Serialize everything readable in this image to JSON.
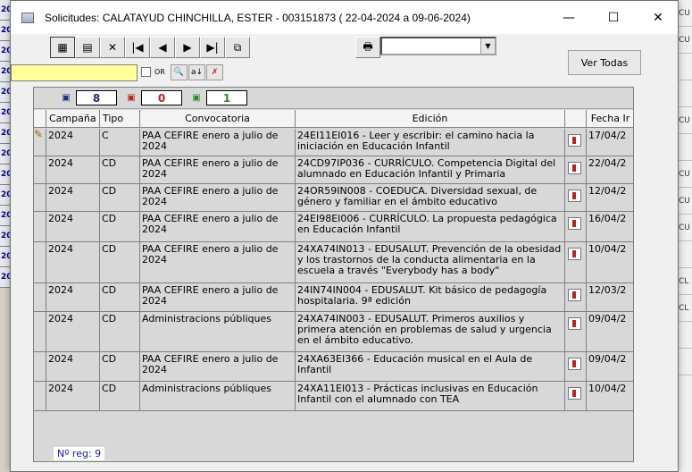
{
  "window": {
    "title": "Solicitudes: CALATAYUD CHINCHILLA, ESTER - 003151873  ( 22-04-2024 a  09-06-2024)"
  },
  "titlebar_controls": {
    "minimize": "—",
    "maximize": "☐",
    "close": "✕"
  },
  "toolbar": {
    "buttons": [
      {
        "name": "grid-view-icon",
        "glyph": "▦"
      },
      {
        "name": "form-view-icon",
        "glyph": "▤"
      },
      {
        "name": "cancel-x-icon",
        "glyph": "✕"
      },
      {
        "name": "first-record-icon",
        "glyph": "|◀"
      },
      {
        "name": "prev-record-icon",
        "glyph": "◀"
      },
      {
        "name": "next-record-icon",
        "glyph": "▶"
      },
      {
        "name": "last-record-icon",
        "glyph": "▶|"
      },
      {
        "name": "copy-records-icon",
        "glyph": "⧉"
      }
    ],
    "print": "🖶",
    "combo_arrow": "▼"
  },
  "ver_todas_label": "Ver Todas",
  "search": {
    "or_label": "OR",
    "find_glyph": "🔍",
    "sort_glyph": "a↓",
    "clear_glyph": "✗"
  },
  "counters": [
    {
      "icon": "doc-check-icon",
      "color": "#1f2f7a",
      "value": "8"
    },
    {
      "icon": "doc-x-icon",
      "color": "#c02020",
      "value": "0"
    },
    {
      "icon": "doc-ok-icon",
      "color": "#2a8a2a",
      "value": "1"
    }
  ],
  "columns": [
    "Campaña",
    "Tipo",
    "Convocatoria",
    "Edición",
    "",
    "Fecha Ir"
  ],
  "rows": [
    {
      "edit": "✎",
      "campana": "2024",
      "tipo": "C",
      "convocatoria": "PAA CEFIRE enero a julio de 2024",
      "edicion": "24EI11EI016 - Leer y escribir: el camino hacia la iniciación en Educación Infantil",
      "fecha": "17/04/2",
      "h": 31
    },
    {
      "edit": "",
      "campana": "2024",
      "tipo": "CD",
      "convocatoria": "PAA CEFIRE enero a julio de 2024",
      "edicion": "24CD97IP036 - CURRÍCULO. Competencia Digital del alumnado en Educación Infantil y Primaria",
      "fecha": "22/04/2",
      "h": 31
    },
    {
      "edit": "",
      "campana": "2024",
      "tipo": "CD",
      "convocatoria": "PAA CEFIRE enero a julio de 2024",
      "edicion": "24OR59IN008 - COEDUCA. Diversidad sexual, de género y familiar en el ámbito educativo",
      "fecha": "12/04/2",
      "h": 31
    },
    {
      "edit": "",
      "campana": "2024",
      "tipo": "CD",
      "convocatoria": "PAA CEFIRE enero a julio de 2024",
      "edicion": "24EI98EI006 - CURRÍCULO. La propuesta pedagógica en Educación Infantil",
      "fecha": "16/04/2",
      "h": 34
    },
    {
      "edit": "",
      "campana": "2024",
      "tipo": "CD",
      "convocatoria": "PAA CEFIRE enero a julio de 2024",
      "edicion": "24XA74IN013 - EDUSALUT. Prevención de la obesidad y los trastornos de la conducta alimentaria en la escuela a través \"Everybody has a body\"",
      "fecha": "10/04/2",
      "h": 46
    },
    {
      "edit": "",
      "campana": "2024",
      "tipo": "CD",
      "convocatoria": "PAA CEFIRE enero a julio de 2024",
      "edicion": "24IN74IN004 - EDUSALUT. Kit básico de pedagogía hospitalaria. 9ª edición",
      "fecha": "12/03/2",
      "h": 32
    },
    {
      "edit": "",
      "campana": "2024",
      "tipo": "CD",
      "convocatoria": "Administracions públiques",
      "edicion": "24XA74IN003 - EDUSALUT. Primeros auxilios y primera atención en problemas de salud y urgencia en el ámbito educativo.",
      "fecha": "09/04/2",
      "h": 45
    },
    {
      "edit": "",
      "campana": "2024",
      "tipo": "CD",
      "convocatoria": "PAA CEFIRE enero a julio de 2024",
      "edicion": "24XA63EI366 - Educación musical en el Aula de Infantil",
      "fecha": "09/04/2",
      "h": 33
    },
    {
      "edit": "",
      "campana": "2024",
      "tipo": "CD",
      "convocatoria": "Administracions públiques",
      "edicion": "24XA11EI013 - Prácticas inclusivas en Educación Infantil con el alumnado con TEA",
      "fecha": "10/04/2",
      "h": 33
    }
  ],
  "footer": {
    "nreg": "Nº reg: 9"
  },
  "background": {
    "left": [
      "20",
      "20",
      "20",
      "20",
      "20",
      "20",
      "20",
      "20",
      "20",
      "20",
      "20",
      "20",
      "20",
      "20"
    ],
    "right": [
      "CU",
      "CU",
      "",
      "",
      "CU",
      "",
      "CU",
      "CU",
      "CU",
      "",
      "CL",
      "CL",
      "",
      ""
    ]
  }
}
